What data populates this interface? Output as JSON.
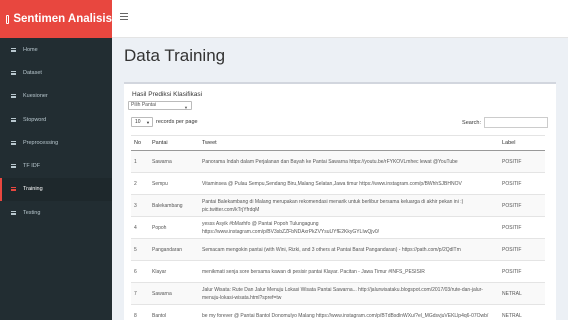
{
  "brand": {
    "title": "Sentimen Analisis"
  },
  "sidebar": {
    "items": [
      {
        "label": "Home",
        "active": false
      },
      {
        "label": "Dataset",
        "active": false
      },
      {
        "label": "Kuesioner",
        "active": false
      },
      {
        "label": "Stopword",
        "active": false
      },
      {
        "label": "Preprocessing",
        "active": false
      },
      {
        "label": "TF IDF",
        "active": false
      },
      {
        "label": "Training",
        "active": true
      },
      {
        "label": "Testing",
        "active": false
      }
    ]
  },
  "page": {
    "title": "Data Training"
  },
  "box": {
    "title": "Hasil Prediksi Klasifikasi",
    "select_value": "Pilih Pantai",
    "length_value": "10",
    "length_suffix": "records per page",
    "search_label": "Search:"
  },
  "table": {
    "headers": [
      "No",
      "Pantai",
      "Tweet",
      "Label"
    ],
    "rows": [
      {
        "no": "1",
        "pantai": "Sawarna",
        "tweet": "Panorama Indah dalam Perjalanan dan Bayah ke Pantai Sawarna https://youtu.be/rFYKOVLmhec lewat @YouTube",
        "label": "POSITIF"
      },
      {
        "no": "2",
        "pantai": "Sempu",
        "tweet": "Vitaminsea @ Pulau Sempu,Sendang Biru,Malang Selatan,Jawa timur https://www.instagram.com/p/BWhhSJBHNOV",
        "label": "POSITIF"
      },
      {
        "no": "3",
        "pantai": "Balekambang",
        "tweet": "Pantai Balekambang di Malang merupakan rekomendasi menarik untuk berlibur bersama keluarga di akhir pekan ini :) pic.twitter.com/kTrjYfrdqM",
        "label": "POSITIF"
      },
      {
        "no": "4",
        "pantai": "Popoh",
        "tweet": "yesss Asyik #bMarhfo @ Pantai Popoh Tulungagung https://www.instagram.com/p/BV3sbZZFbNDAxrPkZVYsuUYfE2KkyGYLIwQjv0/",
        "label": "POSITIF"
      },
      {
        "no": "5",
        "pantai": "Pangandaran",
        "tweet": "Semacam mengokin pantai (with Wini, Rizki, and 3 others at Pantai Barat Pangandaran) - https://path.com/p/2QdlTm",
        "label": "POSITIF"
      },
      {
        "no": "6",
        "pantai": "Klayar",
        "tweet": "menikmati senja sore bersama kawan di pesisir pantai Klayar. Pacitan - Jawa Timur #INFS_PESISIR",
        "label": "POSITIF"
      },
      {
        "no": "7",
        "pantai": "Sawarna",
        "tweet": "Jalur Wisata: Rute Dan Jalur Menuju Lokasi Wisata Pantai Sawarna... http://jalurwisataku.blogspot.com/2017/03/rute-dan-jalur-menuju-lokasi-wisata.html?spref=tw",
        "label": "NETRAL"
      },
      {
        "no": "8",
        "pantai": "Bantol",
        "tweet": "be my forever @ Pantai Bantol Donomulyo Malang https://www.instagram.com/p/BTdBsdlnWXu/?el_MGdsvjuVEKLlp4q6-07Owb/",
        "label": "NETRAL"
      }
    ]
  }
}
